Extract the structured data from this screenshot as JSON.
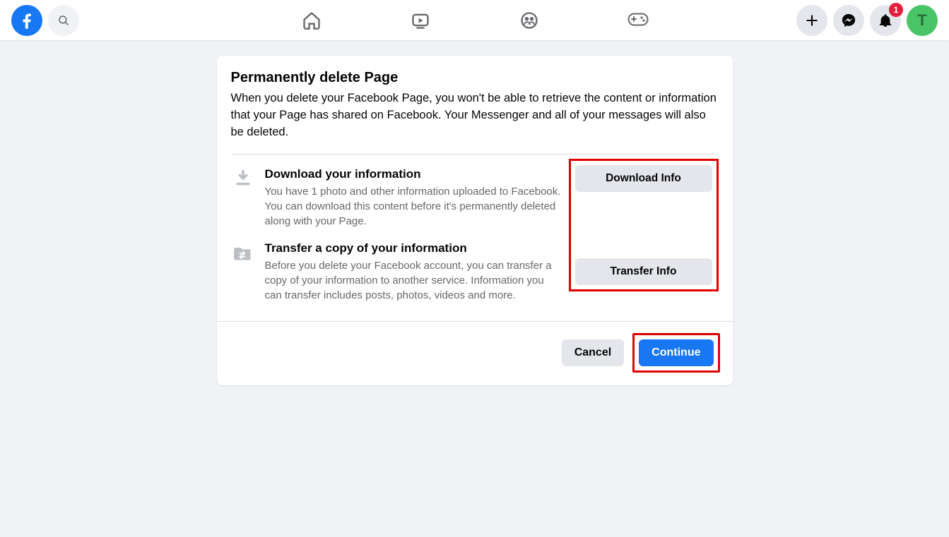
{
  "header": {
    "notification_count": "1",
    "avatar_initial": "T"
  },
  "card": {
    "title": "Permanently delete Page",
    "description": "When you delete your Facebook Page, you won't be able to retrieve the content or information that your Page has shared on Facebook. Your Messenger and all of your messages will also be deleted.",
    "options": [
      {
        "title": "Download your information",
        "description": "You have 1 photo and other information uploaded to Facebook. You can download this content before it's permanently deleted along with your Page.",
        "button": "Download Info"
      },
      {
        "title": "Transfer a copy of your information",
        "description": "Before you delete your Facebook account, you can transfer a copy of your information to another service. Information you can transfer includes posts, photos, videos and more.",
        "button": "Transfer Info"
      }
    ],
    "footer": {
      "cancel": "Cancel",
      "continue": "Continue"
    }
  }
}
